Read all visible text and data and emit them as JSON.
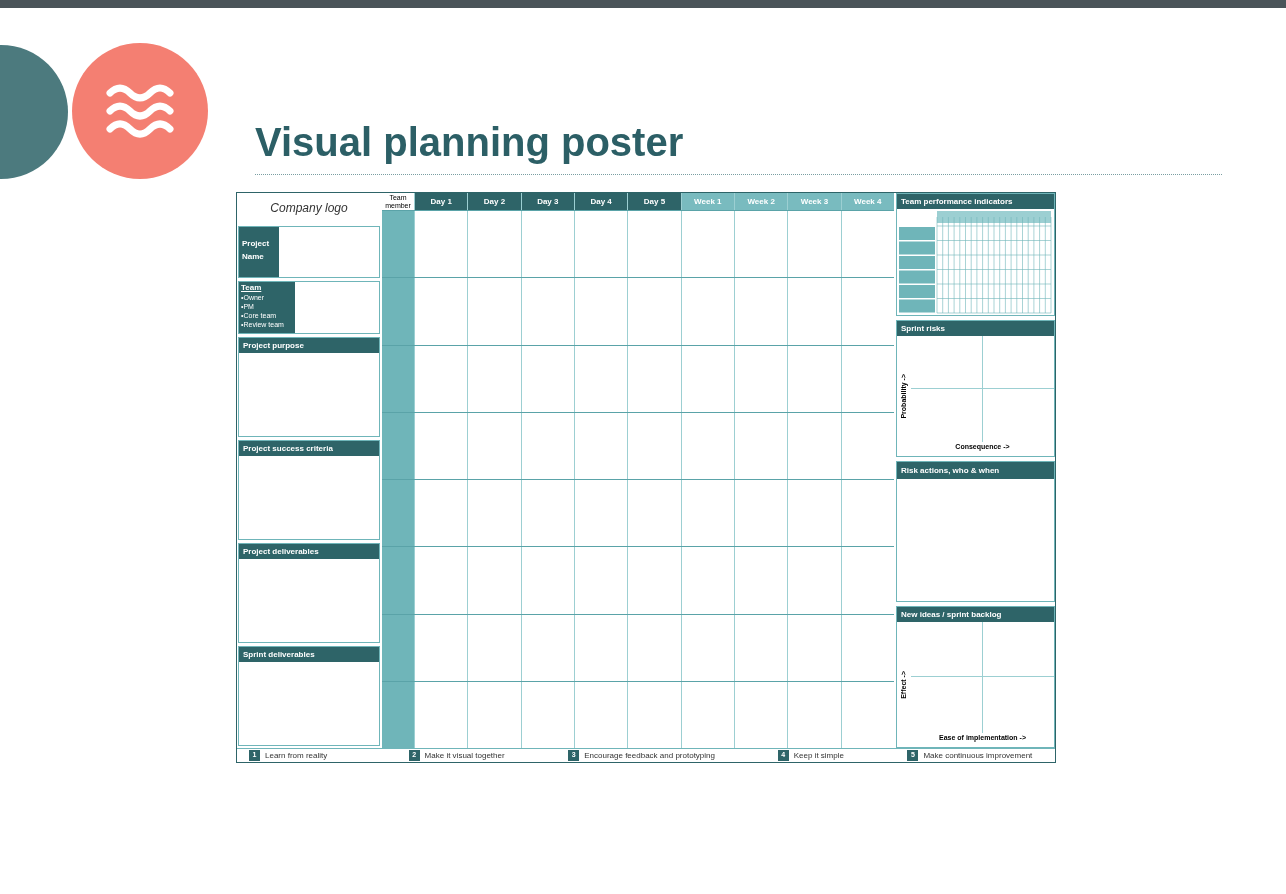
{
  "slide": {
    "title": "Visual planning poster"
  },
  "poster": {
    "logo": "Company logo",
    "project_name": "Project Name",
    "team": {
      "heading": "Team",
      "members": [
        "•Owner",
        "•PM",
        "•Core team",
        "•Review team"
      ]
    },
    "left_sections": [
      "Project purpose",
      "Project success criteria",
      "Project deliverables",
      "Sprint deliverables"
    ],
    "grid": {
      "corner": "Team member",
      "columns": [
        {
          "label": "Day 1",
          "kind": "day"
        },
        {
          "label": "Day 2",
          "kind": "day"
        },
        {
          "label": "Day 3",
          "kind": "day"
        },
        {
          "label": "Day 4",
          "kind": "day"
        },
        {
          "label": "Day 5",
          "kind": "day"
        },
        {
          "label": "Week 1",
          "kind": "week"
        },
        {
          "label": "Week 2",
          "kind": "week"
        },
        {
          "label": "Week 3",
          "kind": "week"
        },
        {
          "label": "Week 4",
          "kind": "week"
        }
      ]
    },
    "kpi": {
      "heading": "Team performance indicators"
    },
    "risks": {
      "heading": "Sprint risks",
      "y_axis": "Probability ->",
      "x_axis": "Consequence ->"
    },
    "actions": {
      "heading": "Risk actions, who & when"
    },
    "ideas": {
      "heading": "New ideas / sprint backlog",
      "y_axis": "Effect ->",
      "x_axis": "Ease of implementation ->"
    },
    "principles": [
      {
        "number": "1",
        "text": "Learn from reality"
      },
      {
        "number": "2",
        "text": "Make it visual together"
      },
      {
        "number": "3",
        "text": "Encourage feedback and prototyping"
      },
      {
        "number": "4",
        "text": "Keep it simple"
      },
      {
        "number": "5",
        "text": "Make continuous improvement"
      }
    ]
  }
}
